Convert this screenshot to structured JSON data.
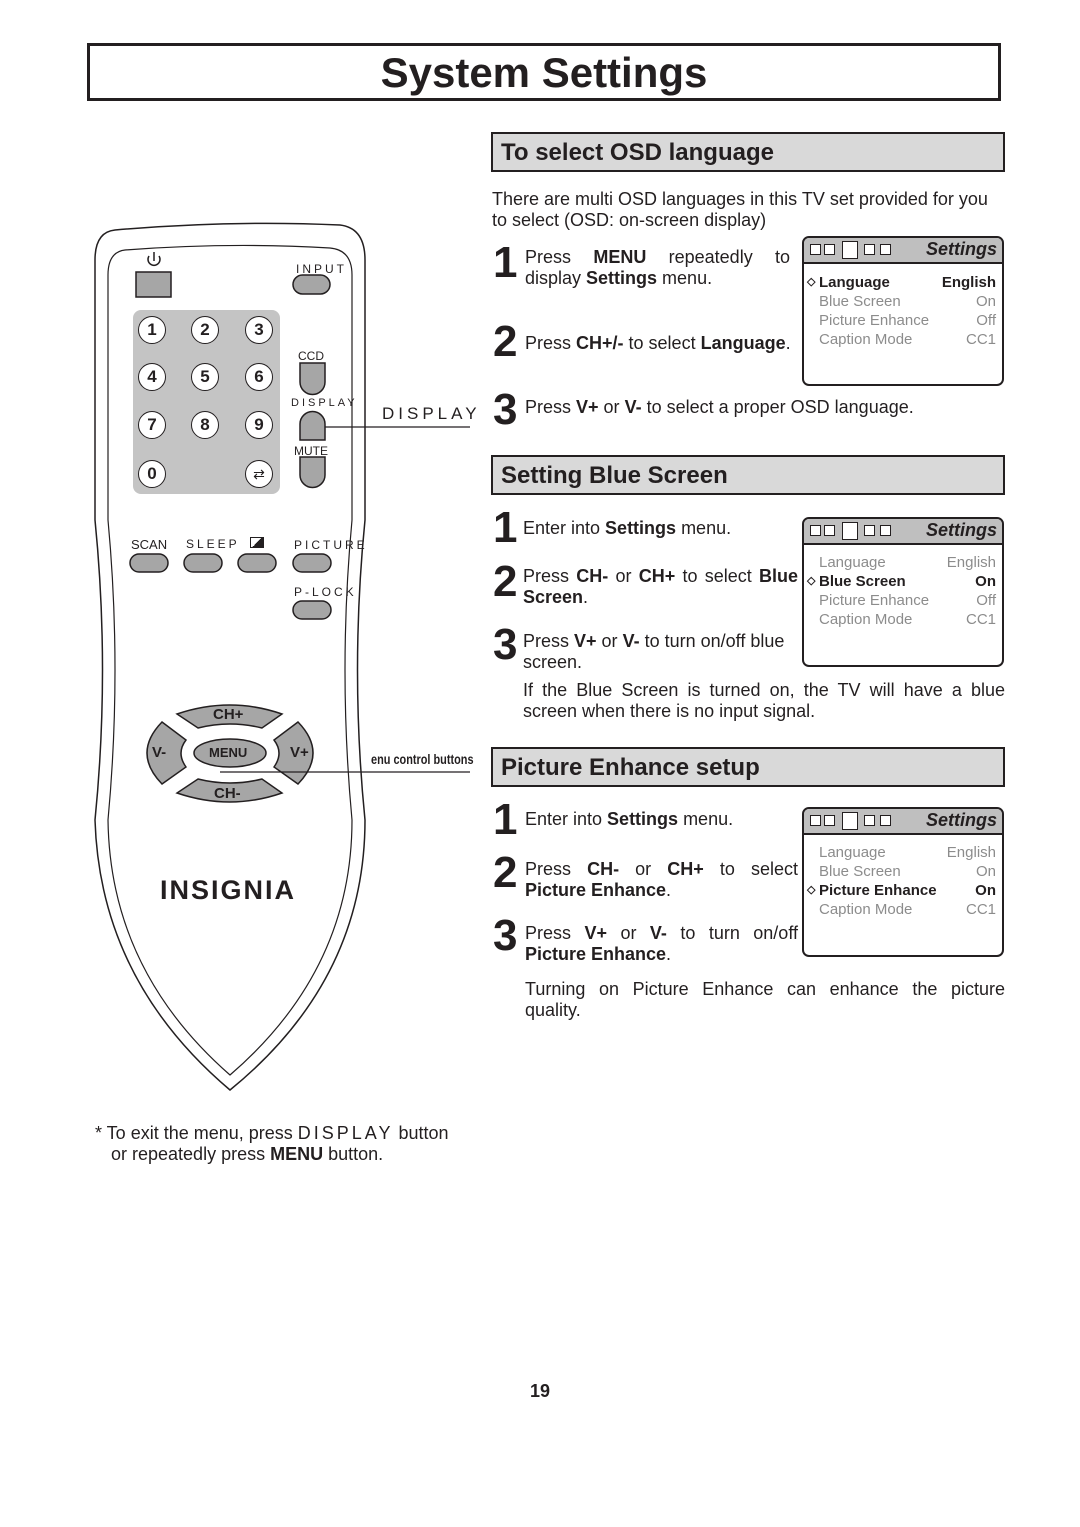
{
  "page_title": "System Settings",
  "page_number": "19",
  "sections": [
    {
      "heading": "To select OSD language",
      "intro": [
        "There are multi OSD languages in this TV set provided for you",
        "to select (OSD: on-screen display)"
      ],
      "steps": [
        {
          "num": "1",
          "parts": [
            "Press ",
            "MENU",
            " repeatedly to display ",
            "Settings",
            " menu."
          ]
        },
        {
          "num": "2",
          "parts": [
            "Press ",
            "CH+/-",
            " to select ",
            "Language",
            "."
          ]
        },
        {
          "num": "3",
          "parts": [
            "Press ",
            "V+",
            " or ",
            "V-",
            " to select a proper OSD language."
          ]
        }
      ],
      "osd": {
        "title": "Settings",
        "selected": 0,
        "rows": [
          {
            "label": "Language",
            "value": "English"
          },
          {
            "label": "Blue Screen",
            "value": "On"
          },
          {
            "label": "Picture Enhance",
            "value": "Off"
          },
          {
            "label": "Caption Mode",
            "value": "CC1"
          }
        ]
      }
    },
    {
      "heading": "Setting Blue Screen",
      "steps": [
        {
          "num": "1",
          "parts": [
            "Enter into ",
            "Settings",
            " menu."
          ]
        },
        {
          "num": "2",
          "parts": [
            "Press ",
            "CH-",
            " or ",
            "CH+",
            " to select ",
            "Blue Screen",
            "."
          ]
        },
        {
          "num": "3",
          "parts": [
            "Press ",
            "V+",
            " or ",
            "V-",
            " to turn on/off blue screen."
          ]
        }
      ],
      "note": "If the Blue Screen is turned on, the TV will have a blue screen when there is no input signal.",
      "osd": {
        "title": "Settings",
        "selected": 1,
        "rows": [
          {
            "label": "Language",
            "value": "English"
          },
          {
            "label": "Blue Screen",
            "value": "On"
          },
          {
            "label": "Picture Enhance",
            "value": "Off"
          },
          {
            "label": "Caption Mode",
            "value": "CC1"
          }
        ]
      }
    },
    {
      "heading": "Picture Enhance setup",
      "steps": [
        {
          "num": "1",
          "parts": [
            "Enter into ",
            "Settings",
            " menu."
          ]
        },
        {
          "num": "2",
          "parts": [
            "Press ",
            "CH-",
            " or ",
            "CH+",
            " to select ",
            "Picture Enhance",
            "."
          ]
        },
        {
          "num": "3",
          "parts": [
            "Press ",
            "V+",
            " or ",
            "V-",
            " to turn on/off ",
            "Picture Enhance",
            "."
          ]
        }
      ],
      "note": "Turning on Picture Enhance can enhance the picture quality.",
      "osd": {
        "title": "Settings",
        "selected": 2,
        "rows": [
          {
            "label": "Language",
            "value": "English"
          },
          {
            "label": "Blue Screen",
            "value": "On"
          },
          {
            "label": "Picture Enhance",
            "value": "On"
          },
          {
            "label": "Caption Mode",
            "value": "CC1"
          }
        ]
      }
    }
  ],
  "remote": {
    "brand": "INSIGNIA",
    "labels": {
      "input": "INPUT",
      "ccd": "CCD",
      "display": "DISPLAY",
      "mute": "MUTE",
      "scan": "SCAN",
      "sleep": "SLEEP",
      "picture": "PICTURE",
      "plock": "P-LOCK",
      "ch_up": "CH+",
      "ch_down": "CH-",
      "vol_down": "V-",
      "vol_up": "V+",
      "menu": "MENU"
    },
    "digits": [
      "1",
      "2",
      "3",
      "4",
      "5",
      "6",
      "7",
      "8",
      "9",
      "0"
    ],
    "callouts": {
      "display": "DISPLAY",
      "menu_controls": "enu control buttons"
    }
  },
  "footnote": {
    "line1_prefix": "* To exit the menu, press ",
    "line1_key": "DISPLAY",
    "line1_suffix": " button",
    "line2_prefix": "or repeatedly press ",
    "line2_key": "MENU",
    "line2_suffix": " button."
  }
}
